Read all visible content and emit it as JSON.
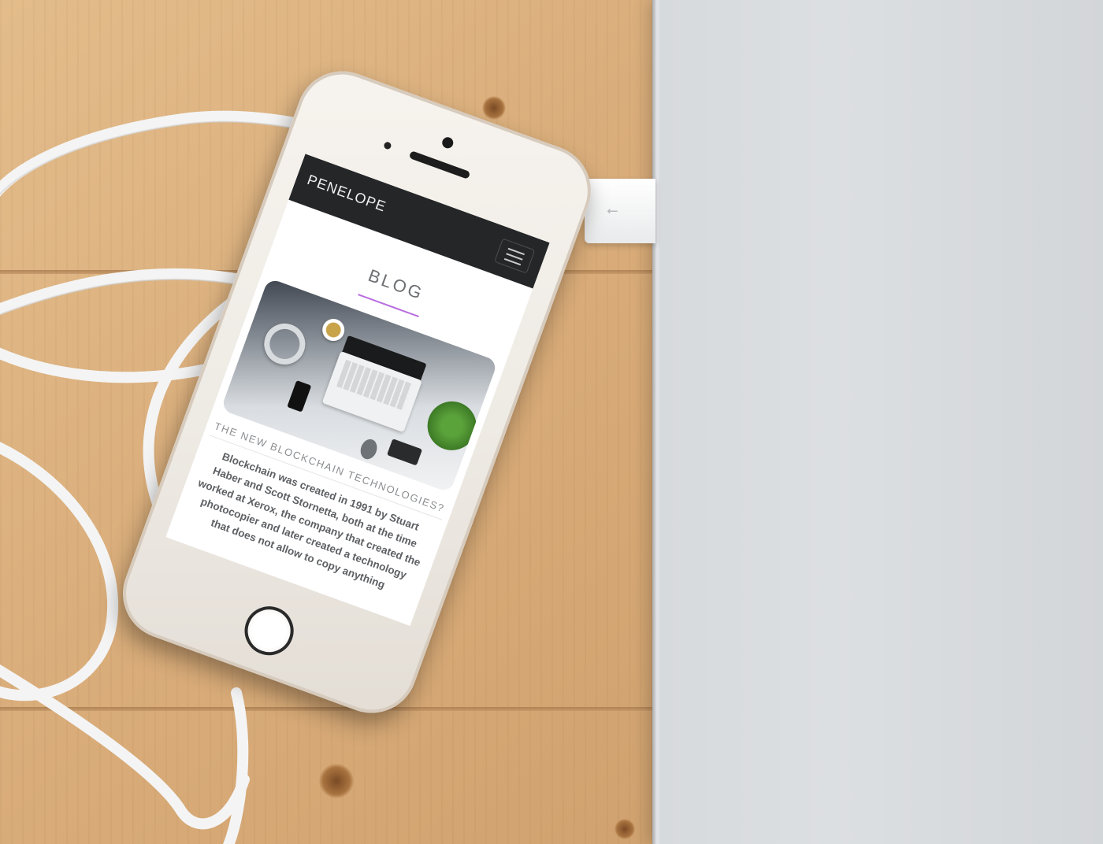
{
  "site": {
    "brand": "PENELOPE",
    "menu_icon": "hamburger-menu-icon"
  },
  "page": {
    "heading": "BLOG",
    "accent_color": "#b86ee0"
  },
  "post": {
    "title": "THE NEW BLOCKCHAIN TECHNOLOGIES?",
    "excerpt": "Blockchain was created in 1991 by Stuart Haber and Scott Stornetta, both at the time worked at Xerox, the company that created the photocopier and later created a technology that does not allow to copy anything"
  },
  "colors": {
    "navbar": "#242628",
    "heading_text": "#6d6f72",
    "body_text": "#5d6063"
  }
}
